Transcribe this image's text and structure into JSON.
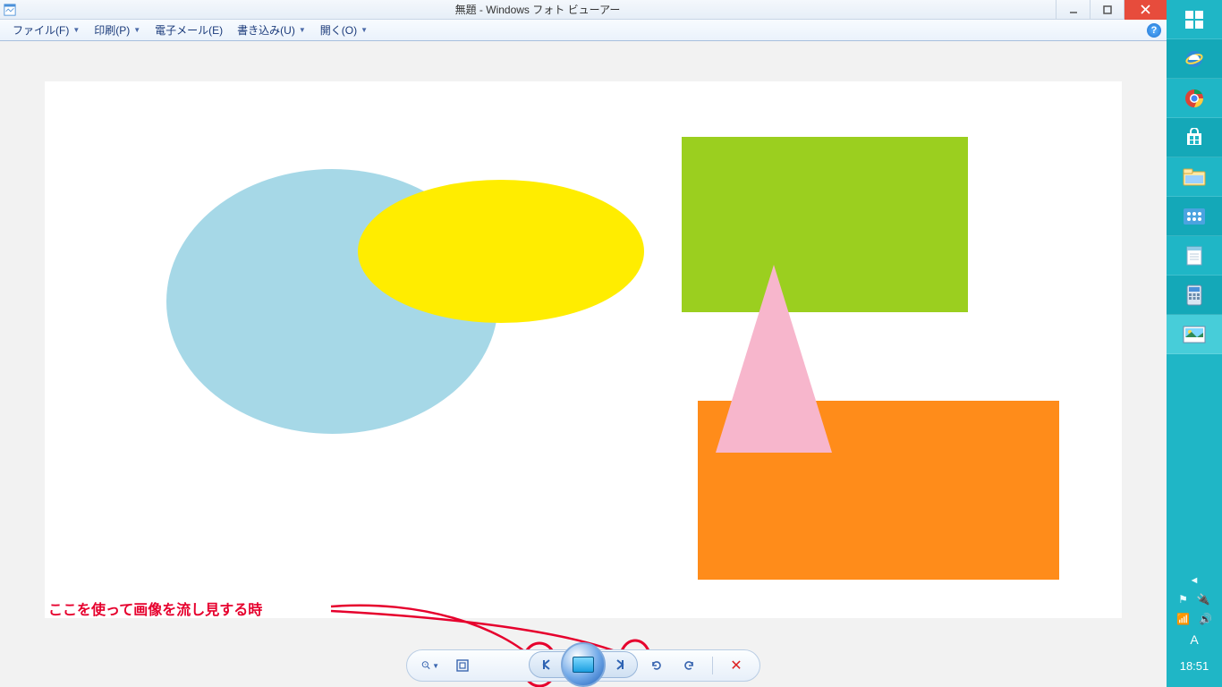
{
  "window": {
    "title": "無題 - Windows フォト ビューアー"
  },
  "menu": {
    "file": "ファイル(F)",
    "print": "印刷(P)",
    "email": "電子メール(E)",
    "burn": "書き込み(U)",
    "open": "開く(O)",
    "help": "?"
  },
  "annotation": {
    "text": "ここを使って画像を流し見する時"
  },
  "toolbar": {
    "zoom": "zoom-dropdown",
    "fit": "fit-to-window",
    "prev": "previous-image",
    "slide": "play-slideshow",
    "next": "next-image",
    "rot_ccw": "rotate-left",
    "rot_cw": "rotate-right",
    "delete": "delete"
  },
  "taskbar": {
    "items": [
      "start",
      "ie",
      "chrome",
      "store",
      "explorer",
      "control-panel",
      "notepad",
      "calculator",
      "photo-viewer"
    ],
    "ime": "A",
    "clock": "18:51"
  },
  "colors": {
    "blue_ellipse": "#a6d8e7",
    "yellow_ellipse": "#ffed00",
    "green_rect": "#9bcf1f",
    "pink_triangle": "#f7b6cc",
    "orange_rect": "#ff8c1a",
    "annotation_red": "#e6002d",
    "taskbar_teal": "#1fb6c6"
  }
}
